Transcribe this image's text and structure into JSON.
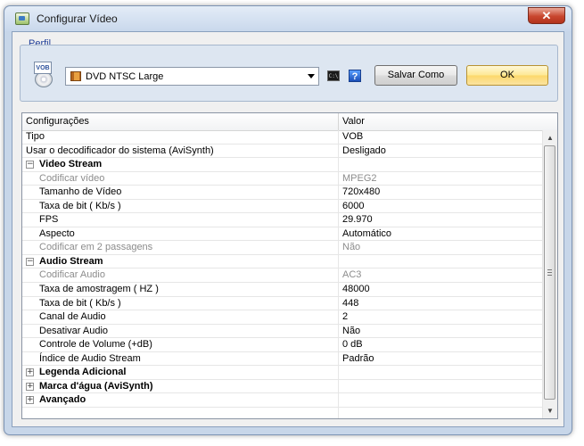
{
  "window": {
    "title": "Configurar Vídeo",
    "close_glyph": "✕"
  },
  "profile": {
    "legend": "Perfil",
    "icon_text": "VOB",
    "selected": "DVD NTSC Large",
    "cmd_text": "C:\\",
    "help_text": "?",
    "save_as_label": "Salvar Como",
    "ok_label": "OK"
  },
  "grid": {
    "headers": [
      "Configurações",
      "Valor"
    ],
    "rows": [
      {
        "type": "top",
        "name": "Tipo",
        "value": "VOB"
      },
      {
        "type": "top",
        "name": "Usar o decodificador do sistema (AviSynth)",
        "value": "Desligado"
      },
      {
        "type": "cat",
        "name": "Video Stream",
        "expanded": true
      },
      {
        "type": "prop",
        "name": "Codificar vídeo",
        "value": "MPEG2",
        "disabled": true
      },
      {
        "type": "prop",
        "name": "Tamanho de Vídeo",
        "value": "720x480"
      },
      {
        "type": "prop",
        "name": "Taxa de bit ( Kb/s )",
        "value": "6000"
      },
      {
        "type": "prop",
        "name": "FPS",
        "value": "29.970"
      },
      {
        "type": "prop",
        "name": "Aspecto",
        "value": "Automático"
      },
      {
        "type": "prop",
        "name": "Codificar em 2 passagens",
        "value": "Não",
        "disabled": true
      },
      {
        "type": "cat",
        "name": "Audio Stream",
        "expanded": true
      },
      {
        "type": "prop",
        "name": "Codificar Audio",
        "value": "AC3",
        "disabled": true
      },
      {
        "type": "prop",
        "name": "Taxa de amostragem ( HZ )",
        "value": "48000"
      },
      {
        "type": "prop",
        "name": "Taxa de bit ( Kb/s )",
        "value": "448"
      },
      {
        "type": "prop",
        "name": "Canal de Audio",
        "value": "2"
      },
      {
        "type": "prop",
        "name": "Desativar Audio",
        "value": "Não"
      },
      {
        "type": "prop",
        "name": "Controle de Volume (+dB)",
        "value": "0 dB"
      },
      {
        "type": "prop",
        "name": "Índice de Audio Stream",
        "value": "Padrão"
      },
      {
        "type": "cat",
        "name": "Legenda Adicional",
        "expanded": false
      },
      {
        "type": "cat",
        "name": "Marca d'água (AviSynth)",
        "expanded": false
      },
      {
        "type": "cat",
        "name": "Avançado",
        "expanded": false
      },
      {
        "type": "blank",
        "name": "",
        "value": ""
      }
    ]
  },
  "colors": {
    "accent": "#fcd86b",
    "disabled_text": "#8c8c8c",
    "window_frame": "#c7d6e9"
  }
}
